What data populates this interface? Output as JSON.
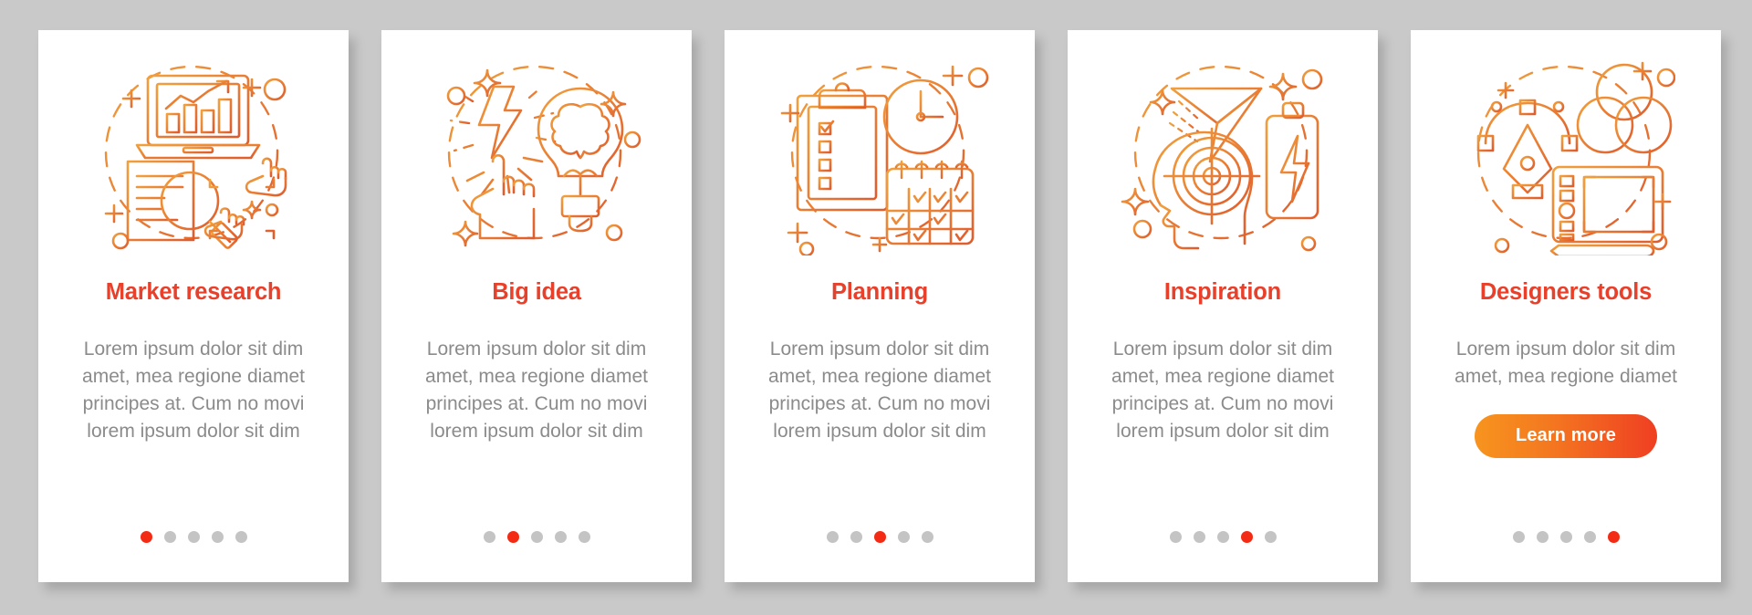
{
  "theme": {
    "background": "#c9c9c9",
    "card_background": "#ffffff",
    "title_color": "#e8402a",
    "body_color": "#8b8b8b",
    "dot_inactive": "#c4c4c4",
    "dot_active": "#f42b14",
    "button_gradient_from": "#f7941e",
    "button_gradient_to": "#ef3f22",
    "illustration_stroke_from": "#f2a03c",
    "illustration_stroke_to": "#e05b2c"
  },
  "cards": [
    {
      "icon": "market-research-illustration",
      "title": "Market research",
      "body": "Lorem ipsum dolor sit dim amet, mea regione diamet principes at. Cum no movi lorem ipsum dolor sit dim",
      "dots_total": 5,
      "dots_active_index": 0,
      "has_button": false,
      "button_label": ""
    },
    {
      "icon": "big-idea-illustration",
      "title": "Big idea",
      "body": "Lorem ipsum dolor sit dim amet, mea regione diamet principes at. Cum no movi lorem ipsum dolor sit dim",
      "dots_total": 5,
      "dots_active_index": 1,
      "has_button": false,
      "button_label": ""
    },
    {
      "icon": "planning-illustration",
      "title": "Planning",
      "body": "Lorem ipsum dolor sit dim amet, mea regione diamet principes at. Cum no movi lorem ipsum dolor sit dim",
      "dots_total": 5,
      "dots_active_index": 2,
      "has_button": false,
      "button_label": ""
    },
    {
      "icon": "inspiration-illustration",
      "title": "Inspiration",
      "body": "Lorem ipsum dolor sit dim amet, mea regione diamet principes at. Cum no movi lorem ipsum dolor sit dim",
      "dots_total": 5,
      "dots_active_index": 3,
      "has_button": false,
      "button_label": ""
    },
    {
      "icon": "designers-tools-illustration",
      "title": "Designers tools",
      "body": "Lorem ipsum dolor sit dim amet, mea regione diamet",
      "dots_total": 5,
      "dots_active_index": 4,
      "has_button": true,
      "button_label": "Learn more"
    }
  ]
}
